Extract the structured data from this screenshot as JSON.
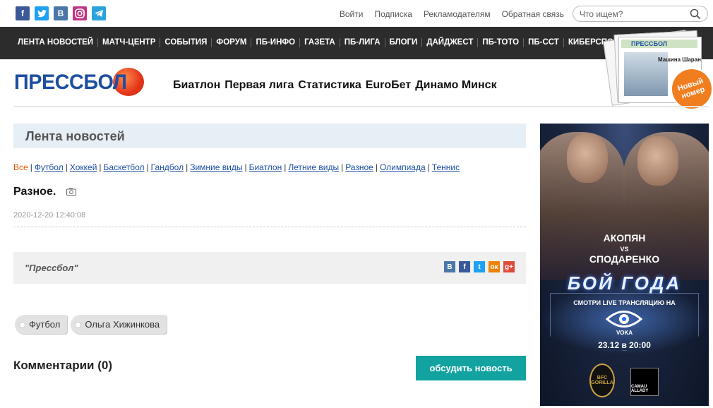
{
  "social": [
    {
      "name": "facebook",
      "color": "#3b5998",
      "glyph": "f"
    },
    {
      "name": "twitter",
      "color": "#1da1f2",
      "glyph": ""
    },
    {
      "name": "vkontakte",
      "color": "#4a76a8",
      "glyph": "В"
    },
    {
      "name": "instagram",
      "color": "#c13584",
      "glyph": ""
    },
    {
      "name": "telegram",
      "color": "#2aa3dd",
      "glyph": ""
    }
  ],
  "top_links": [
    "Войти",
    "Подписка",
    "Рекламодателям",
    "Обратная связь"
  ],
  "search": {
    "placeholder": "Что ищем?"
  },
  "nav": [
    "ЛЕНТА НОВОСТЕЙ",
    "МАТЧ-ЦЕНТР",
    "СОБЫТИЯ",
    "ФОРУМ",
    "ПБ-ИНФО",
    "ГАЗЕТА",
    "ПБ-ЛИГА",
    "БЛОГИ",
    "ДАЙДЖЕСТ",
    "ПБ-ТОТО",
    "ПБ-ССТ",
    "КИБЕРСПОРТ"
  ],
  "logo": {
    "text": "ПРЕССБОЛ"
  },
  "quick_links": [
    "Биатлон",
    "Первая лига",
    "Статистика",
    "EuroБет",
    "Динамо Минск"
  ],
  "promo": {
    "paper_name": "ПРЕССБОЛ",
    "caption": "Машина Шаран",
    "badge": "Новый номер"
  },
  "section": {
    "title": "Лента новостей"
  },
  "categories": [
    {
      "label": "Все",
      "active": true
    },
    {
      "label": "Футбол"
    },
    {
      "label": "Хоккей"
    },
    {
      "label": "Баскетбол"
    },
    {
      "label": "Гандбол"
    },
    {
      "label": "Зимние виды"
    },
    {
      "label": "Биатлон"
    },
    {
      "label": "Летние виды"
    },
    {
      "label": "Разное"
    },
    {
      "label": "Олимпиада"
    },
    {
      "label": "Теннис"
    }
  ],
  "article": {
    "title": "Разное.",
    "date": "2020-12-20 12:40:08",
    "source": "\"Прессбол\""
  },
  "share": [
    {
      "name": "vk",
      "color": "#4a76a8",
      "glyph": "В"
    },
    {
      "name": "facebook",
      "color": "#3b5998",
      "glyph": "f"
    },
    {
      "name": "twitter",
      "color": "#1da1f2",
      "glyph": "t"
    },
    {
      "name": "odnoklassniki",
      "color": "#ee8208",
      "glyph": "ок"
    },
    {
      "name": "googleplus",
      "color": "#dd4b39",
      "glyph": "g+"
    }
  ],
  "tags": [
    "Футбол",
    "Ольга Хижинкова"
  ],
  "comments": {
    "title": "Комментарии (0)",
    "button": "обсудить новость"
  },
  "ad": {
    "fighter1": "АКОПЯН",
    "vs": "VS",
    "fighter2": "СПОДАРЕНКО",
    "headline": "БОЙ ГОДА",
    "subline": "СМОТРИ LIVE ТРАНСЛЯЦИЮ НА",
    "platform": "VOKA",
    "datetime": "23.12 в 20:00",
    "sponsor1": "BFC GORILLA",
    "sponsor2": "CAMAU ALLADY"
  }
}
